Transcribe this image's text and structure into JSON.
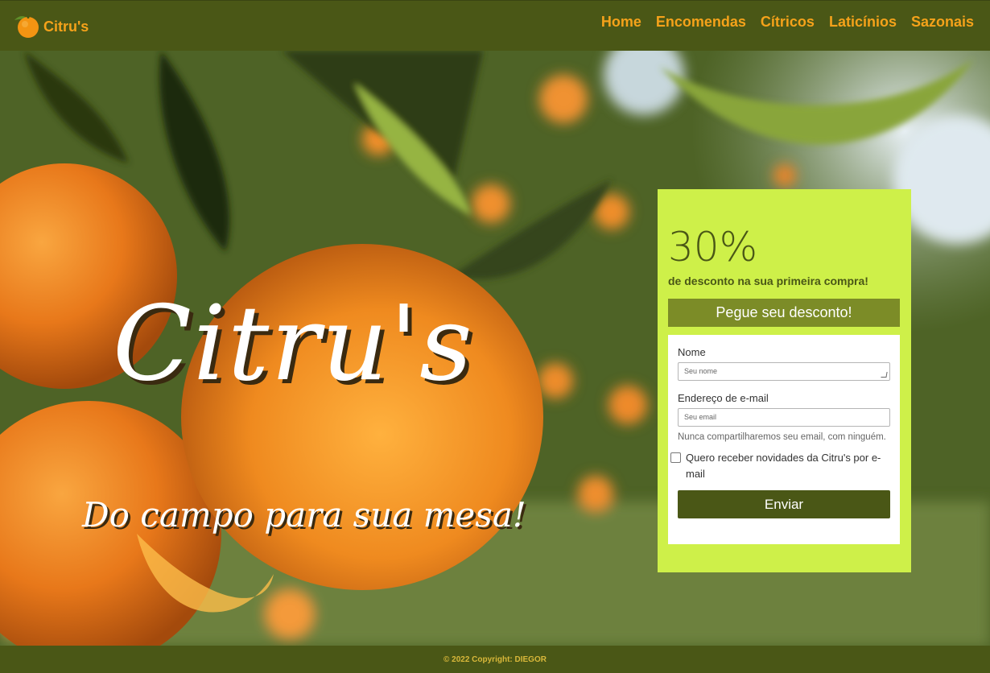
{
  "brand": {
    "name": "Citru's",
    "icon": "orange-logo-icon"
  },
  "nav": {
    "items": [
      {
        "label": "Home"
      },
      {
        "label": "Encomendas"
      },
      {
        "label": "Cítricos"
      },
      {
        "label": "Laticínios"
      },
      {
        "label": "Sazonais"
      }
    ]
  },
  "hero": {
    "title": "Citru's",
    "subtitle": "Do campo para sua mesa!"
  },
  "promo": {
    "percent": "30%",
    "description": "de desconto na sua primeira compra!",
    "cta_label": "Pegue seu desconto!",
    "form": {
      "name_label": "Nome",
      "name_placeholder": "Seu nome",
      "email_label": "Endereço de e-mail",
      "email_placeholder": "Seu email",
      "email_help": "Nunca compartilharemos seu email, com ninguém.",
      "newsletter_label": "Quero receber novidades da Citru's por e-mail",
      "newsletter_checked": false,
      "submit_label": "Enviar"
    }
  },
  "footer": {
    "copyright": "© 2022 Copyright: DIEGOR"
  },
  "colors": {
    "nav_bg": "#4a5716",
    "nav_text": "#f5a21a",
    "promo_bg": "#cef049",
    "cta_bg": "#7c8c27",
    "submit_bg": "#4a5716",
    "footer_text": "#d9b83a"
  }
}
